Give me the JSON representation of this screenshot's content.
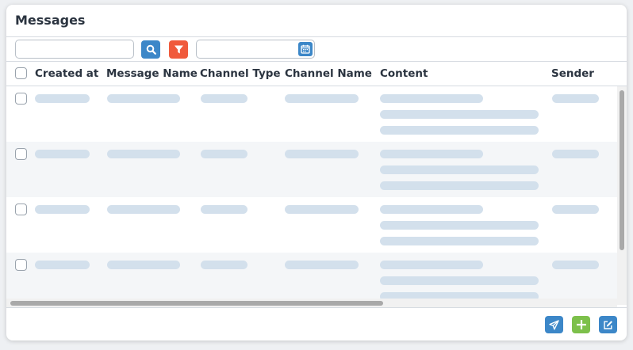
{
  "panel": {
    "title": "Messages"
  },
  "toolbar": {
    "search_value": "",
    "date_value": ""
  },
  "columns": [
    "Created at",
    "Message Name",
    "Channel Type",
    "Channel Name",
    "Content",
    "Sender"
  ],
  "rows_state": "loading",
  "icons": {
    "search": "search-icon",
    "filter": "filter-icon",
    "calendar": "calendar-icon",
    "send": "send-icon",
    "add": "plus-icon",
    "edit": "edit-icon"
  },
  "colors": {
    "primary": "#3c87c8",
    "danger": "#f05a3c",
    "success": "#7dc04b",
    "placeholder": "#d3e0ec"
  }
}
